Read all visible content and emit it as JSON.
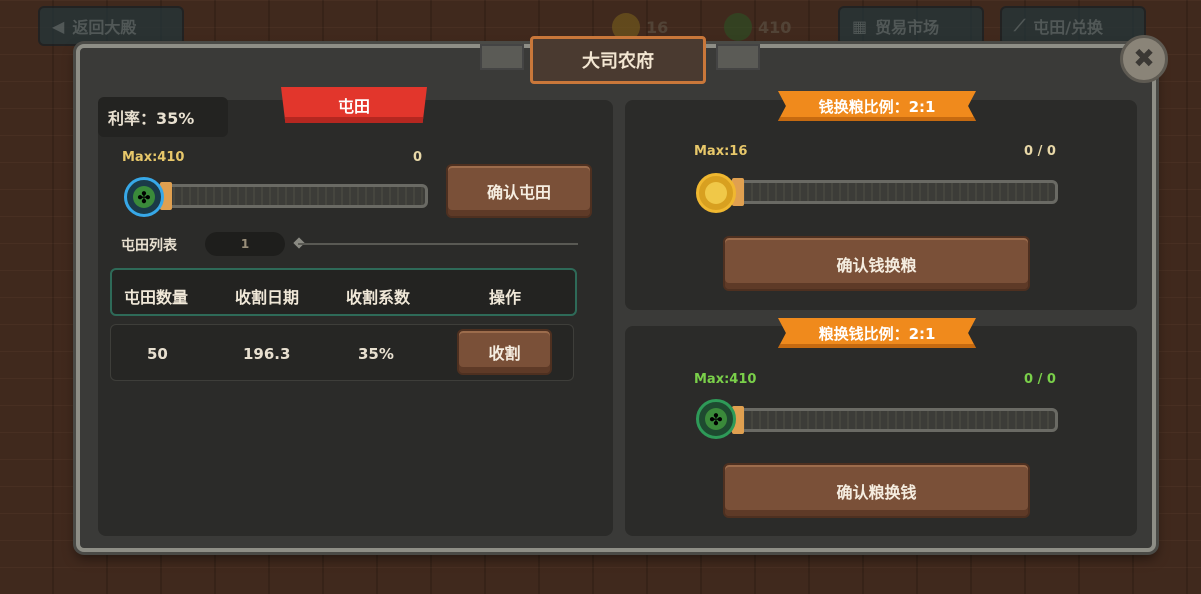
{
  "top_bar": {
    "back_label": "返回大殿",
    "coins": "16",
    "grain": "410",
    "market_label": "贸易市场",
    "tuntian_exchange_label": "屯田/兑换"
  },
  "dialog": {
    "title": "大司农府",
    "close_glyph": "✖"
  },
  "farm": {
    "rate": "利率：35%",
    "tab": "屯田",
    "max": "Max:410",
    "value": "0",
    "confirm": "确认屯田",
    "list_label": "屯田列表",
    "list_page": "1",
    "columns": [
      "屯田数量",
      "收割日期",
      "收割系数",
      "操作"
    ],
    "rows": [
      {
        "quantity": "50",
        "date": "196.3",
        "factor": "35%",
        "action": "收割"
      }
    ]
  },
  "coin_to_grain": {
    "ratio": "钱换粮比例：2:1",
    "max": "Max:16",
    "value": "0 / 0",
    "confirm": "确认钱换粮"
  },
  "grain_to_coin": {
    "ratio": "粮换钱比例：2:1",
    "max": "Max:410",
    "value": "0 / 0",
    "confirm": "确认粮换钱"
  },
  "colors": {
    "accent_red": "#e2362c",
    "ribbon_orange": "#f08a1c",
    "button_brown": "#7a5038",
    "max_yellow": "#e8c86a",
    "max_green": "#7ad04a"
  },
  "icons": {
    "back": "arrow-left-icon",
    "market": "shop-icon",
    "tuntian": "shovel-icon",
    "coin": "coin-icon",
    "grain": "clover-icon",
    "close": "close-icon"
  }
}
